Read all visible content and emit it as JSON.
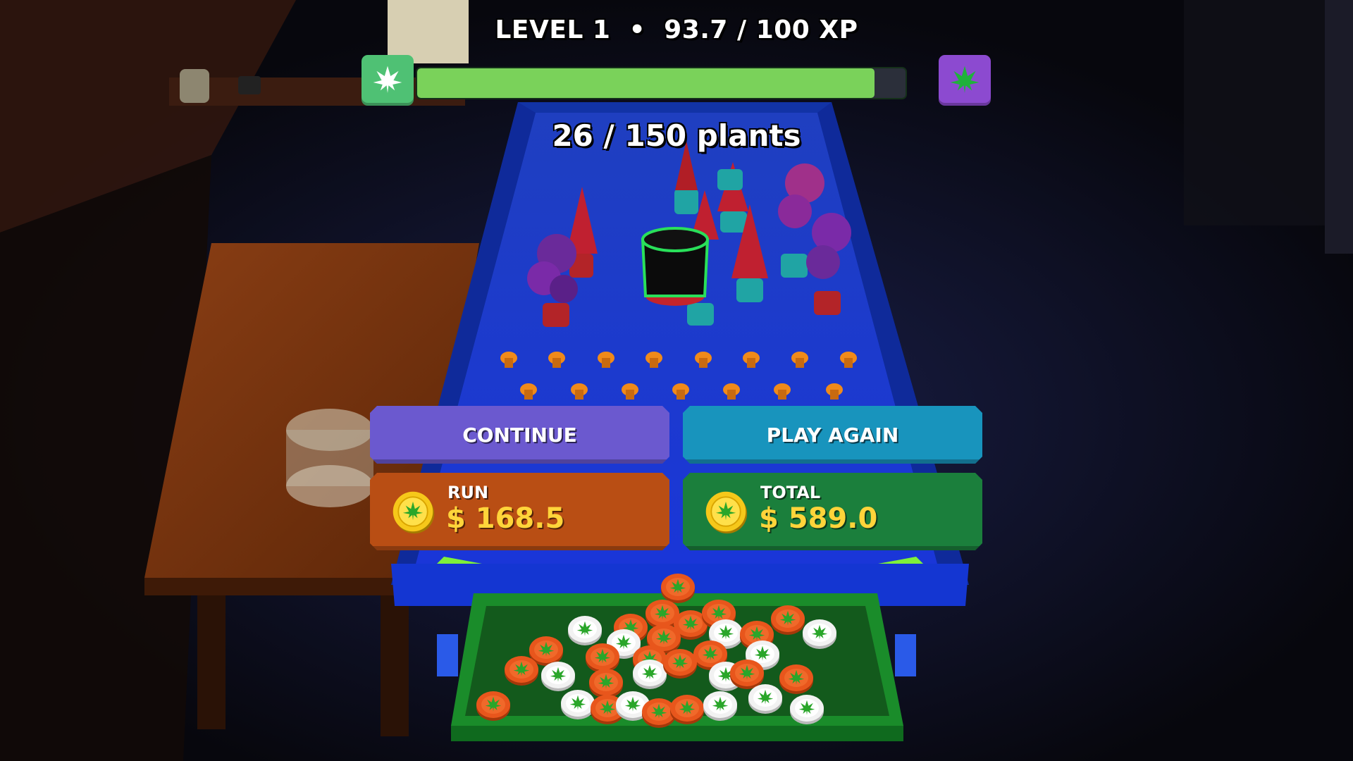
{
  "hud": {
    "level_label": "LEVEL 1",
    "separator": "•",
    "xp_text": "93.7 / 100 XP",
    "xp_progress": 0.937,
    "left_icon": "cannabis-leaf-icon",
    "right_icon": "cannabis-leaf-icon",
    "plants_text": "26 / 150 plants"
  },
  "buttons": {
    "continue_label": "CONTINUE",
    "play_again_label": "PLAY AGAIN"
  },
  "stats": {
    "run": {
      "label": "RUN",
      "value": "$ 168.5",
      "icon": "gold-coin-icon"
    },
    "total": {
      "label": "TOTAL",
      "value": "$ 589.0",
      "icon": "gold-coin-icon"
    }
  },
  "colors": {
    "xp_fill": "#7ad25a",
    "left_badge": "#4fc174",
    "right_badge": "#8c4ad0",
    "continue_button": "#6b59cf",
    "play_again_button": "#1894bd",
    "run_panel": "#b94e14",
    "total_panel": "#1b7f3c",
    "money_text": "#ffd43a"
  }
}
